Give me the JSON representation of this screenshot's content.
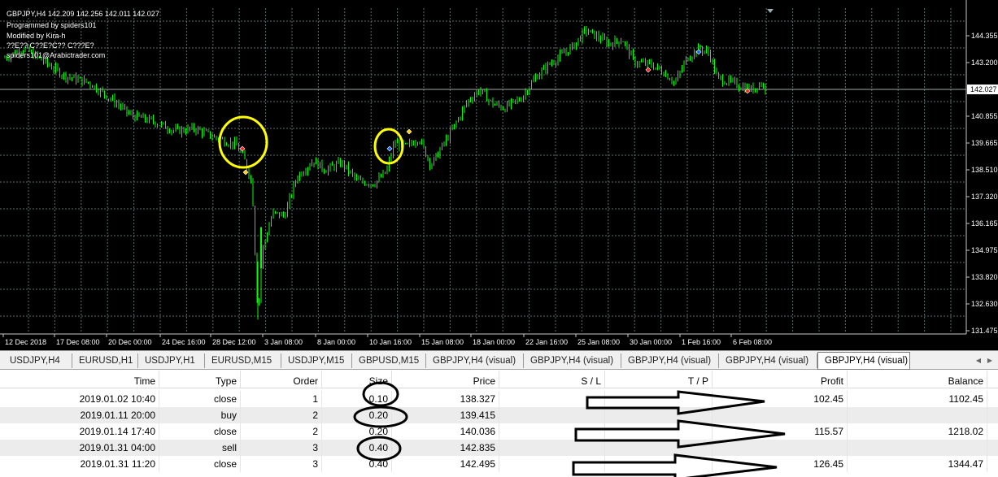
{
  "chart": {
    "info_lines": [
      "GBPJPY,H4  142.209 142.256 142.011 142.027",
      "Programmed by spiders101",
      "Modified by Kira-h",
      "??E?? C??E?C?? C???E?",
      "spiders101@Arabictrader.com"
    ],
    "price_levels": [
      "144.355",
      "143.200",
      "142.027",
      "140.855",
      "139.665",
      "138.510",
      "137.320",
      "136.165",
      "134.975",
      "133.820",
      "132.630",
      "131.475"
    ],
    "current_price": "142.027",
    "time_labels": [
      "12 Dec 2018",
      "17 Dec 08:00",
      "20 Dec 00:00",
      "24 Dec 16:00",
      "28 Dec 12:00",
      "3 Jan 08:00",
      "8 Jan 00:00",
      "10 Jan 16:00",
      "15 Jan 08:00",
      "18 Jan 00:00",
      "22 Jan 16:00",
      "25 Jan 08:00",
      "30 Jan 00:00",
      "1 Feb 16:00",
      "6 Feb 08:00"
    ],
    "colors": {
      "background": "#000000",
      "grid": "#5a6e6e",
      "candle": "#00ff00",
      "text": "#ffffff",
      "price_line": "#a0a8a8",
      "highlight": "#ffff00"
    }
  },
  "tabs": [
    {
      "label": "USDJPY,H4",
      "active": false
    },
    {
      "label": "EURUSD,H1",
      "active": false
    },
    {
      "label": "USDJPY,H1",
      "active": false
    },
    {
      "label": "EURUSD,M15",
      "active": false
    },
    {
      "label": "USDJPY,M15",
      "active": false
    },
    {
      "label": "GBPUSD,M15",
      "active": false
    },
    {
      "label": "GBPJPY,H4 (visual)",
      "active": false
    },
    {
      "label": "GBPJPY,H4 (visual)",
      "active": false
    },
    {
      "label": "GBPJPY,H4 (visual)",
      "active": false
    },
    {
      "label": "GBPJPY,H4 (visual)",
      "active": false
    },
    {
      "label": "GBPJPY,H4 (visual)",
      "active": true
    }
  ],
  "table": {
    "headers": [
      "Time",
      "Type",
      "Order",
      "Size",
      "Price",
      "S / L",
      "T / P",
      "Profit",
      "Balance"
    ],
    "rows": [
      {
        "time": "2019.01.02 10:40",
        "type": "close",
        "order": "1",
        "size": "0.10",
        "price": "138.327",
        "sl": "",
        "tp": "",
        "profit": "102.45",
        "balance": "1102.45"
      },
      {
        "time": "2019.01.11 20:00",
        "type": "buy",
        "order": "2",
        "size": "0.20",
        "price": "139.415",
        "sl": "",
        "tp": "",
        "profit": "",
        "balance": ""
      },
      {
        "time": "2019.01.14 17:40",
        "type": "close",
        "order": "2",
        "size": "0.20",
        "price": "140.036",
        "sl": "",
        "tp": "",
        "profit": "115.57",
        "balance": "1218.02"
      },
      {
        "time": "2019.01.31 04:00",
        "type": "sell",
        "order": "3",
        "size": "0.40",
        "price": "142.835",
        "sl": "",
        "tp": "",
        "profit": "",
        "balance": ""
      },
      {
        "time": "2019.01.31 11:20",
        "type": "close",
        "order": "3",
        "size": "0.40",
        "price": "142.495",
        "sl": "",
        "tp": "",
        "profit": "126.45",
        "balance": "1344.47"
      }
    ]
  }
}
